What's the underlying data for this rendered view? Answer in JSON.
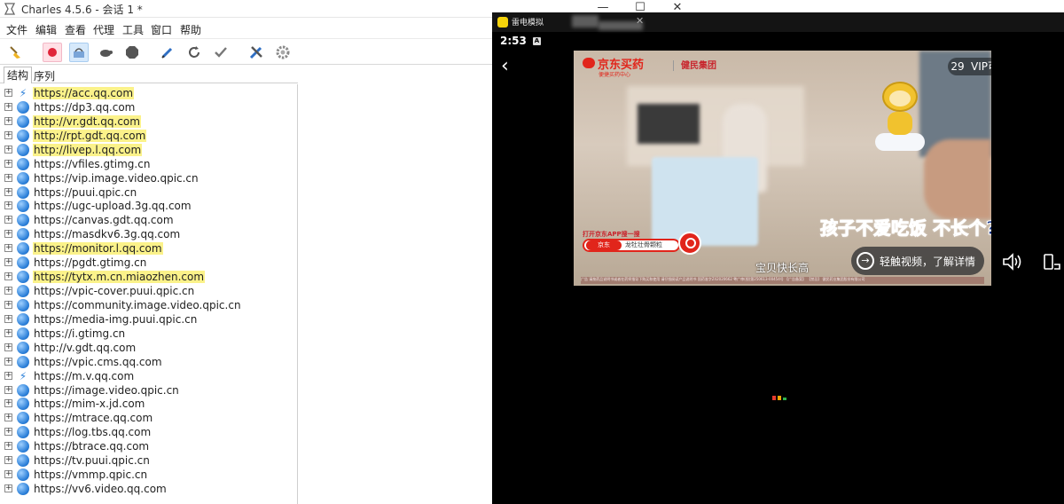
{
  "charles": {
    "title": "Charles 4.5.6 - 会话 1 *",
    "window_controls": [
      "—",
      "☐",
      "✕"
    ],
    "menu": [
      "文件",
      "编辑",
      "查看",
      "代理",
      "工具",
      "窗口",
      "帮助"
    ],
    "toolbar": [
      "broom-icon",
      "record-icon",
      "throttle-icon",
      "turtle-icon",
      "stop-icon",
      "pen-icon",
      "refresh-icon",
      "check-icon",
      "tools-icon",
      "settings-icon"
    ],
    "tabs": [
      "结构",
      "序列"
    ],
    "hosts": [
      {
        "url": "https://acc.qq.com",
        "icon": "bolt",
        "highlight": true
      },
      {
        "url": "https://dp3.qq.com",
        "icon": "globe",
        "highlight": false
      },
      {
        "url": "http://vr.gdt.qq.com",
        "icon": "globe",
        "highlight": true
      },
      {
        "url": "http://rpt.gdt.qq.com",
        "icon": "globe",
        "highlight": true
      },
      {
        "url": "http://livep.l.qq.com",
        "icon": "globe",
        "highlight": true
      },
      {
        "url": "https://vfiles.gtimg.cn",
        "icon": "globe",
        "highlight": false
      },
      {
        "url": "https://vip.image.video.qpic.cn",
        "icon": "globe",
        "highlight": false
      },
      {
        "url": "https://puui.qpic.cn",
        "icon": "globe",
        "highlight": false
      },
      {
        "url": "https://ugc-upload.3g.qq.com",
        "icon": "globe",
        "highlight": false
      },
      {
        "url": "https://canvas.gdt.qq.com",
        "icon": "globe",
        "highlight": false
      },
      {
        "url": "https://masdkv6.3g.qq.com",
        "icon": "globe",
        "highlight": false
      },
      {
        "url": "https://monitor.l.qq.com",
        "icon": "globe",
        "highlight": true
      },
      {
        "url": "https://pgdt.gtimg.cn",
        "icon": "globe",
        "highlight": false
      },
      {
        "url": "https://tytx.m.cn.miaozhen.com",
        "icon": "globe",
        "highlight": true
      },
      {
        "url": "https://vpic-cover.puui.qpic.cn",
        "icon": "globe",
        "highlight": false
      },
      {
        "url": "https://community.image.video.qpic.cn",
        "icon": "globe",
        "highlight": false
      },
      {
        "url": "https://media-img.puui.qpic.cn",
        "icon": "globe",
        "highlight": false
      },
      {
        "url": "https://i.gtimg.cn",
        "icon": "globe",
        "highlight": false
      },
      {
        "url": "http://v.gdt.qq.com",
        "icon": "globe",
        "highlight": false
      },
      {
        "url": "https://vpic.cms.qq.com",
        "icon": "globe",
        "highlight": false
      },
      {
        "url": "https://m.v.qq.com",
        "icon": "bolt",
        "highlight": false
      },
      {
        "url": "https://image.video.qpic.cn",
        "icon": "globe",
        "highlight": false
      },
      {
        "url": "https://mim-x.jd.com",
        "icon": "globe",
        "highlight": false
      },
      {
        "url": "https://mtrace.qq.com",
        "icon": "globe",
        "highlight": false
      },
      {
        "url": "https://log.tbs.qq.com",
        "icon": "globe",
        "highlight": false
      },
      {
        "url": "https://btrace.qq.com",
        "icon": "globe",
        "highlight": false
      },
      {
        "url": "https://tv.puui.qpic.cn",
        "icon": "globe",
        "highlight": false
      },
      {
        "url": "https://vmmp.qpic.cn",
        "icon": "globe",
        "highlight": false
      },
      {
        "url": "https://vv6.video.qq.com",
        "icon": "globe",
        "highlight": false
      }
    ]
  },
  "emulator": {
    "title": "雷电模拟器",
    "close": "✕",
    "clock": "2:53",
    "status_badge": "A",
    "back": "‹",
    "ad": {
      "brand": "京东买药",
      "brand_sub": "便捷买药中心",
      "partner": "健民集团",
      "countdown": "29",
      "vip_close": "VIP可关闭该广告",
      "search_hint": "打开京东APP搜一搜",
      "search_brand": "京东",
      "search_query": "龙牡壮骨颗粒",
      "slogan": "孩子不爱吃饭 不长个?",
      "subtitle": "宝贝快长高",
      "disclaimer": "广告  请按药品说明书或者在药师指导下购买和使用  请仔细阅读产品说明书  国药准字Z42020662  粤广审(视)第250613-00454号  【广告备案】  【禁忌】  健民药业集团股份有限公司"
    },
    "learn_more": "轻触视频，了解详情"
  },
  "colors": {
    "highlight": "#fbf28a",
    "jd_red": "#e1251b",
    "emulator_bg": "#000000"
  }
}
